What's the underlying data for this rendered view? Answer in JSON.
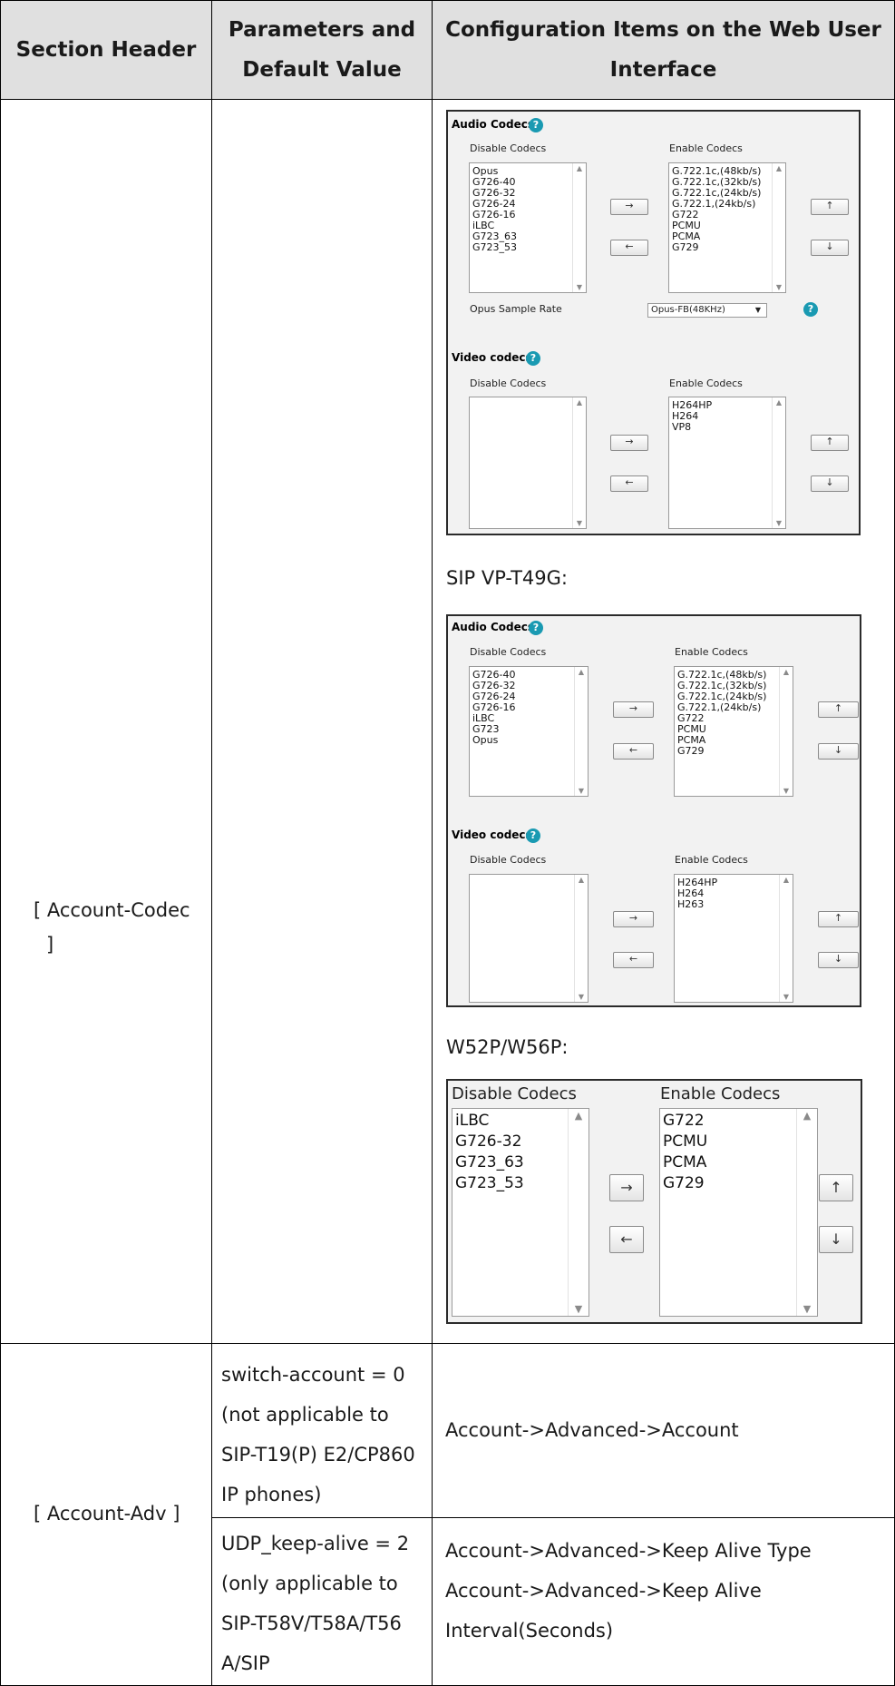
{
  "table": {
    "headers": {
      "section": "Section Header",
      "params": [
        "Parameters and",
        "Default Value"
      ],
      "config": [
        "Configuration Items on the Web User",
        "Interface"
      ]
    },
    "rows": {
      "codec": {
        "section": [
          "[ Account-Codec",
          "]"
        ]
      },
      "adv": {
        "section": "[ Account-Adv ]",
        "sub1": {
          "params": [
            "switch-account = 0",
            "(not applicable to",
            "SIP-T19(P) E2/CP860",
            "IP phones)"
          ],
          "config": "Account->Advanced->Account"
        },
        "sub2": {
          "params": [
            "UDP_keep-alive = 2",
            "(only applicable to",
            "SIP-T58V/T58A/T56",
            "A/SIP"
          ],
          "config": [
            "Account->Advanced->Keep Alive Type",
            "Account->Advanced->Keep Alive",
            "Interval(Seconds)"
          ]
        }
      }
    }
  },
  "panel1": {
    "audio_title": "Audio Codecs",
    "help": "?",
    "disable_label": "Disable Codecs",
    "enable_label": "Enable Codecs",
    "audio_disabled": [
      "Opus",
      "G726-40",
      "G726-32",
      "G726-24",
      "G726-16",
      "iLBC",
      "G723_63",
      "G723_53"
    ],
    "audio_enabled": [
      "G.722.1c,(48kb/s)",
      "G.722.1c,(32kb/s)",
      "G.722.1c,(24kb/s)",
      "G.722.1,(24kb/s)",
      "G722",
      "PCMU",
      "PCMA",
      "G729"
    ],
    "opus_label": "Opus Sample Rate",
    "opus_value": "Opus-FB(48KHz)",
    "video_title": "Video codecs",
    "video_disabled": [],
    "video_enabled": [
      "H264HP",
      "H264",
      "VP8"
    ]
  },
  "model2": "SIP VP-T49G:",
  "panel2": {
    "audio_title": "Audio Codecs",
    "help": "?",
    "disable_label": "Disable Codecs",
    "enable_label": "Enable Codecs",
    "audio_disabled": [
      "G726-40",
      "G726-32",
      "G726-24",
      "G726-16",
      "iLBC",
      "G723",
      "Opus"
    ],
    "audio_enabled": [
      "G.722.1c,(48kb/s)",
      "G.722.1c,(32kb/s)",
      "G.722.1c,(24kb/s)",
      "G.722.1,(24kb/s)",
      "G722",
      "PCMU",
      "PCMA",
      "G729"
    ],
    "video_title": "Video codecs",
    "video_disabled": [],
    "video_enabled": [
      "H264HP",
      "H264",
      "H263"
    ]
  },
  "model3": "W52P/W56P:",
  "panel3": {
    "disable_label": "Disable Codecs",
    "enable_label": "Enable Codecs",
    "disabled": [
      "iLBC",
      "G726-32",
      "G723_63",
      "G723_53"
    ],
    "enabled": [
      "G722",
      "PCMU",
      "PCMA",
      "G729"
    ]
  },
  "arrows": {
    "right": "→",
    "left": "←",
    "up": "↑",
    "down": "↓",
    "sb_up": "▲",
    "sb_down": "▼",
    "dd": "▼"
  }
}
